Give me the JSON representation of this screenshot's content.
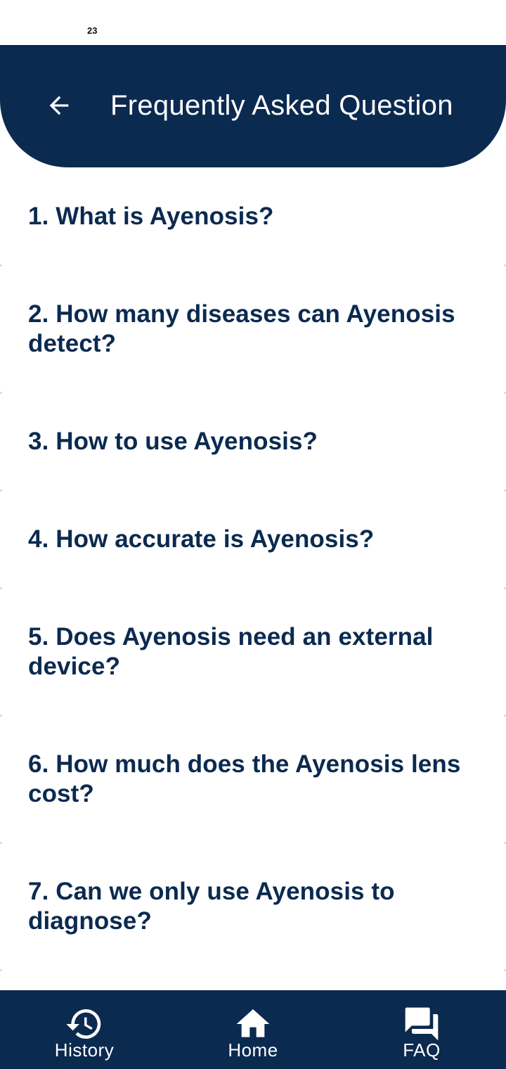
{
  "status_bar": {
    "time": "23"
  },
  "header": {
    "back_icon": "arrow-left-icon",
    "title": "Frequently Asked Question"
  },
  "faq": {
    "items": [
      {
        "question": "1. What is Ayenosis?"
      },
      {
        "question": "2. How many diseases can Ayenosis detect?"
      },
      {
        "question": "3. How to use Ayenosis?"
      },
      {
        "question": "4. How accurate is Ayenosis?"
      },
      {
        "question": "5. Does Ayenosis need an external device?"
      },
      {
        "question": "6. How much does the Ayenosis lens cost?"
      },
      {
        "question": "7. Can we only use Ayenosis to diagnose?"
      }
    ]
  },
  "bottom_nav": {
    "items": [
      {
        "label": "History",
        "icon": "history-icon"
      },
      {
        "label": "Home",
        "icon": "home-icon"
      },
      {
        "label": "FAQ",
        "icon": "forum-icon"
      }
    ]
  },
  "colors": {
    "primary": "#0b2a50",
    "background": "#ffffff",
    "on_primary": "#ffffff"
  }
}
